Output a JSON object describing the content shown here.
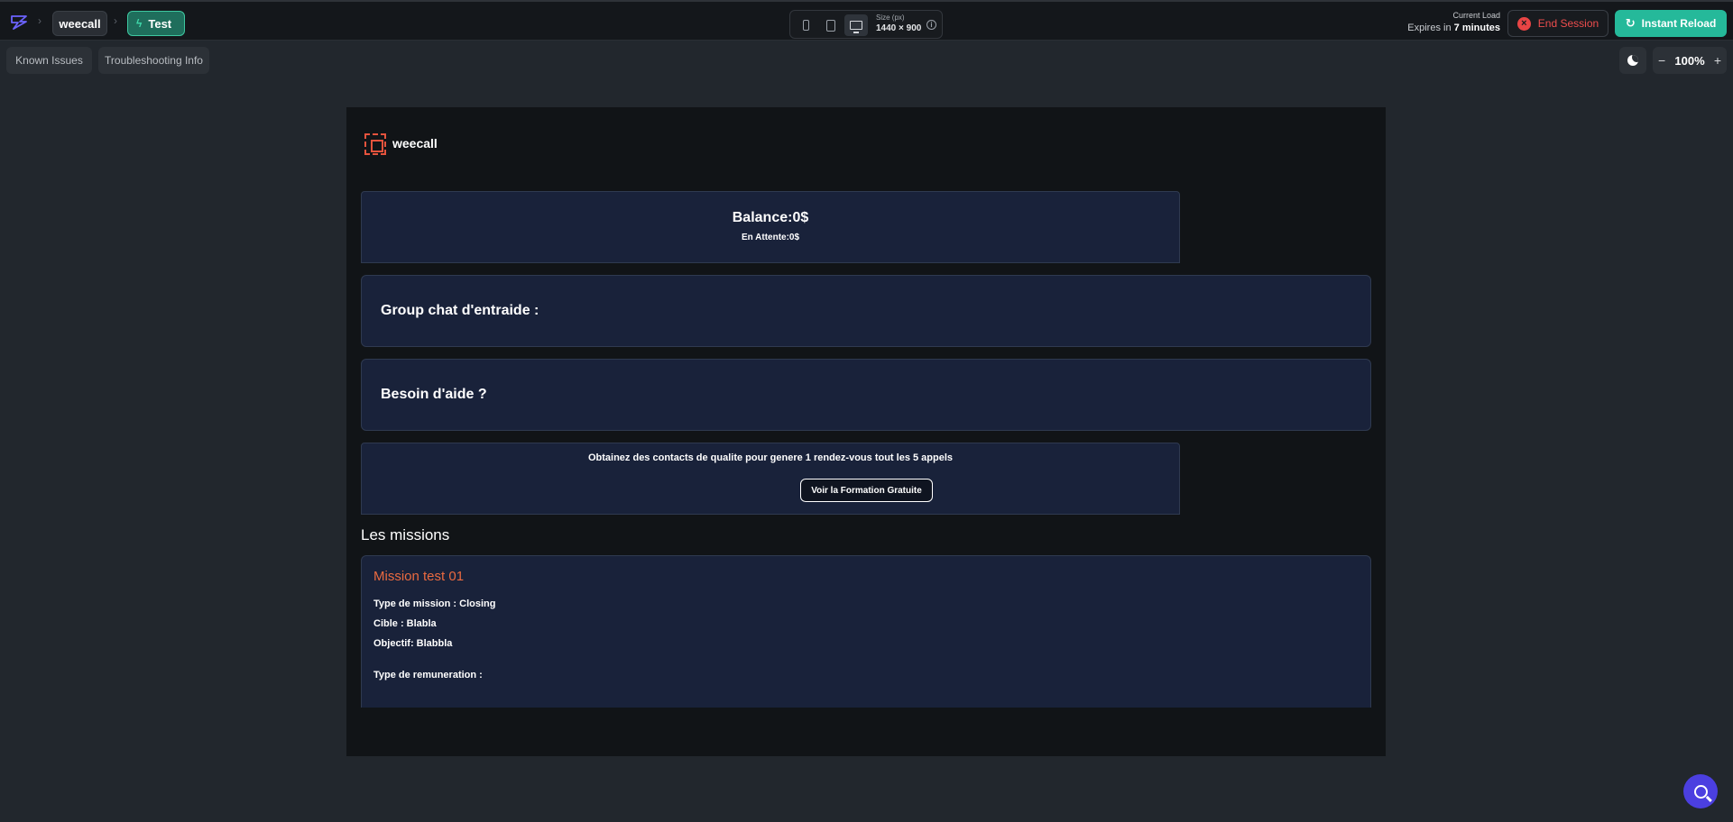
{
  "topbar": {
    "project": "weecall",
    "branch": "Test",
    "size_label": "Size (px)",
    "size_value": "1440 × 900",
    "load_label": "Current Load",
    "expires_prefix": "Expires in",
    "expires_value": "7 minutes",
    "end_session": "End Session",
    "instant_reload": "Instant Reload"
  },
  "toolbar": {
    "known_issues": "Known Issues",
    "troubleshooting": "Troubleshooting Info",
    "zoom_minus": "−",
    "zoom": "100%",
    "zoom_plus": "+"
  },
  "app": {
    "name": "weecall",
    "balance": "Balance:0$",
    "pending": "En Attente:0$",
    "group_chat": "Group chat d'entraide :",
    "help": "Besoin d'aide  ?",
    "formation_text": "Obtainez des contacts de qualite  pour genere 1 rendez-vous tout les 5 appels",
    "formation_button": "Voir la Formation Gratuite",
    "missions_title": "Les missions",
    "missions": [
      {
        "title": "Mission test 01",
        "type": "Type de mission : Closing",
        "target": "Cible : Blabla",
        "goal": "Objectif: Blabbla",
        "remuneration": "Type de remuneration :"
      }
    ]
  },
  "colors": {
    "accent_teal": "#25b99a",
    "danger": "#e84545",
    "mission_title": "#ea6a40",
    "card_bg": "#19223a"
  },
  "icons": [
    "app-logo-icon",
    "phone-icon",
    "tablet-icon",
    "desktop-icon",
    "info-icon",
    "close-circle-icon",
    "reload-icon",
    "moon-icon",
    "weecall-logo-icon",
    "search-icon"
  ]
}
